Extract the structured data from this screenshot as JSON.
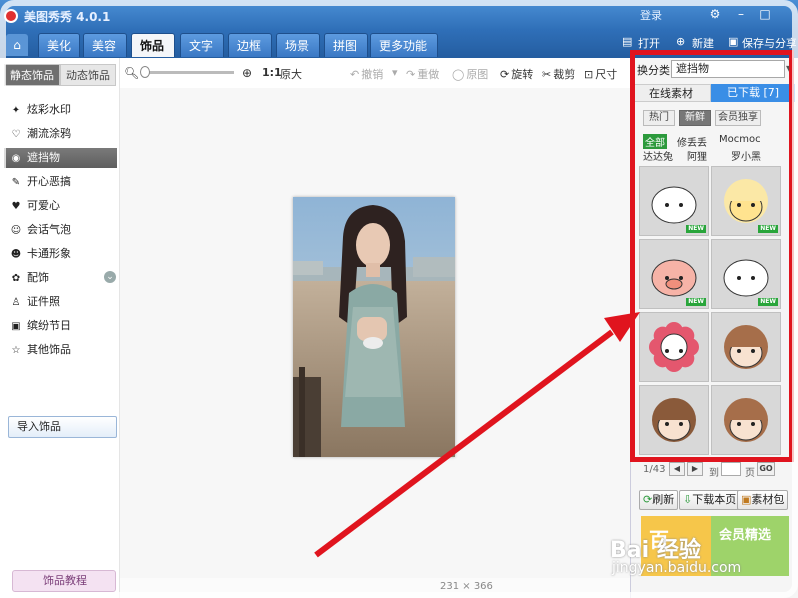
{
  "app": {
    "title": "美图秀秀 4.0.1",
    "login": "登录"
  },
  "menu": {
    "tabs": [
      "美化",
      "美容",
      "饰品",
      "文字",
      "边框",
      "场景",
      "拼图",
      "更多功能 ▾"
    ],
    "active_tab": "饰品",
    "open_label": "打开",
    "new_label": "新建",
    "save_label": "保存与分享"
  },
  "toolbar": {
    "ratio_label": "1:1",
    "original_size": "原大",
    "undo": "撤销",
    "redo": "重做",
    "reset": "原图",
    "rotate": "旋转",
    "crop": "裁剪",
    "size": "尺寸"
  },
  "left": {
    "tabs": [
      "静态饰品",
      "动态饰品"
    ],
    "categories": [
      {
        "label": "炫彩水印",
        "icon": "✦"
      },
      {
        "label": "潮流涂鸦",
        "icon": "♡"
      },
      {
        "label": "遮挡物",
        "icon": "◉"
      },
      {
        "label": "开心恶搞",
        "icon": "✎"
      },
      {
        "label": "可爱心",
        "icon": "♥"
      },
      {
        "label": "会话气泡",
        "icon": "☺"
      },
      {
        "label": "卡通形象",
        "icon": "☻"
      },
      {
        "label": "配饰",
        "icon": "✿"
      },
      {
        "label": "证件照",
        "icon": "♙"
      },
      {
        "label": "缤纷节日",
        "icon": "▣"
      },
      {
        "label": "其他饰品",
        "icon": "☆"
      }
    ],
    "active_category": "遮挡物",
    "import_button": "导入饰品",
    "tutorial_button": "饰品教程"
  },
  "right": {
    "category_label": "换分类",
    "category_value": "遮挡物",
    "online_tab": "在线素材",
    "downloaded_tab": "已下载 [7]",
    "sub_tabs": [
      "热门",
      "新鲜",
      "会员独享"
    ],
    "active_sub_tab": "新鲜",
    "tags": [
      "全部",
      "修丢丢",
      "Mocmoc",
      "达达兔",
      "阿狸",
      "罗小黑"
    ],
    "active_tag": "全部",
    "sticker_badge": "NEW",
    "page": "1/43",
    "goto_label": "到",
    "page_unit": "页",
    "go_button": "GO",
    "refresh_button": "刷新",
    "download_page_button": "下载本页",
    "material_button": "素材包",
    "promo_left": "百",
    "promo_right": "会员精选"
  },
  "status": {
    "dimensions": "231 × 366"
  },
  "watermark": {
    "main": "Bai 经验",
    "sub": "jingyan.baidu.com"
  },
  "colors": {
    "accent_blue": "#2f6fb8",
    "highlight_red": "#e0141e",
    "tag_green": "#2c9a3c"
  }
}
